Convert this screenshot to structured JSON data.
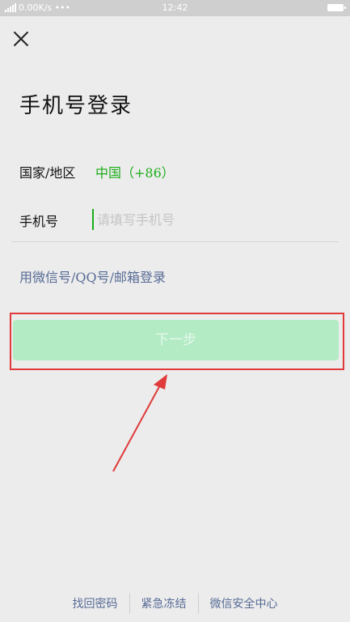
{
  "status_bar": {
    "left": "0.00K/s •••",
    "time": "12:42"
  },
  "header": {
    "close_icon": "close-icon"
  },
  "title": "手机号登录",
  "region": {
    "label": "国家/地区",
    "value": "中国（+86）"
  },
  "phone": {
    "label": "手机号",
    "placeholder": "请填写手机号"
  },
  "alt_login": "用微信号/QQ号/邮箱登录",
  "next_button": "下一步",
  "footer": {
    "links": [
      "找回密码",
      "紧急冻结",
      "微信安全中心"
    ]
  },
  "colors": {
    "accent": "#1aad19",
    "link": "#576b95",
    "button_disabled": "#b3ebc4",
    "annotation": "#e03a3a"
  }
}
